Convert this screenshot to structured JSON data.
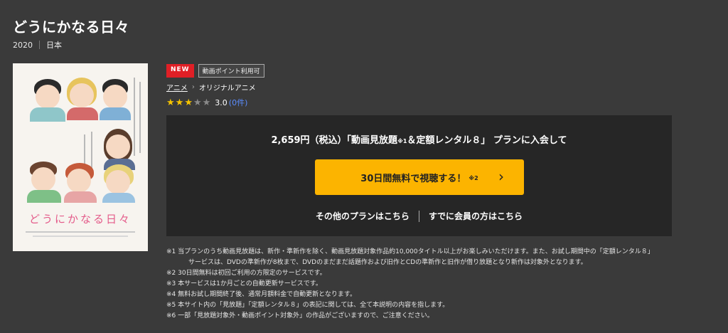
{
  "title": "どうにかなる日々",
  "meta": {
    "year": "2020",
    "country": "日本"
  },
  "poster": {
    "title": "どうにかなる日々"
  },
  "badges": {
    "new": "NEW",
    "point": "動画ポイント利用可"
  },
  "breadcrumb": {
    "category": "アニメ",
    "subcategory": "オリジナルアニメ"
  },
  "rating": {
    "stars_filled": 3,
    "stars_total": 5,
    "score": "3.0",
    "count": "(0件)"
  },
  "plan": {
    "headline_prefix": "2,659円（税込）「動画見放題",
    "headline_note": "※1",
    "headline_suffix": "＆定額レンタル８」 プランに入会して",
    "cta_label": "30日間無料で視聴する！",
    "cta_note": "※2",
    "other_plans": "その他のプランはこちら",
    "members": "すでに会員の方はこちら"
  },
  "notes": [
    "※1 当プランのうち動画見放題は、新作・準新作を除く、動画見放題対象作品約10,000タイトル以上がお楽しみいただけます。また、お試し期間中の「定額レンタル８」",
    "サービスは、DVDの準新作が8枚まで、DVDのまだまだ話題作および旧作とCDの準新作と旧作が借り放題となり新作は対象外となります。",
    "※2 30日間無料は初回ご利用の方限定のサービスです。",
    "※3 本サービスは1か月ごとの自動更新サービスです。",
    "※4 無料お試し期間終了後、通常月額料金で自動更新となります。",
    "※5 本サイト内の「見放題」「定額レンタル８」の表記に関しては、全て本説明の内容を指します。",
    "※6 一部「見放題対象外・動画ポイント対象外」の作品がございますので、ご注意ください。"
  ],
  "colors": {
    "accent": "#fcb400",
    "new_badge": "#e01f26",
    "link": "#5b8dff",
    "background": "#3a3a3a",
    "panel": "#262626"
  }
}
